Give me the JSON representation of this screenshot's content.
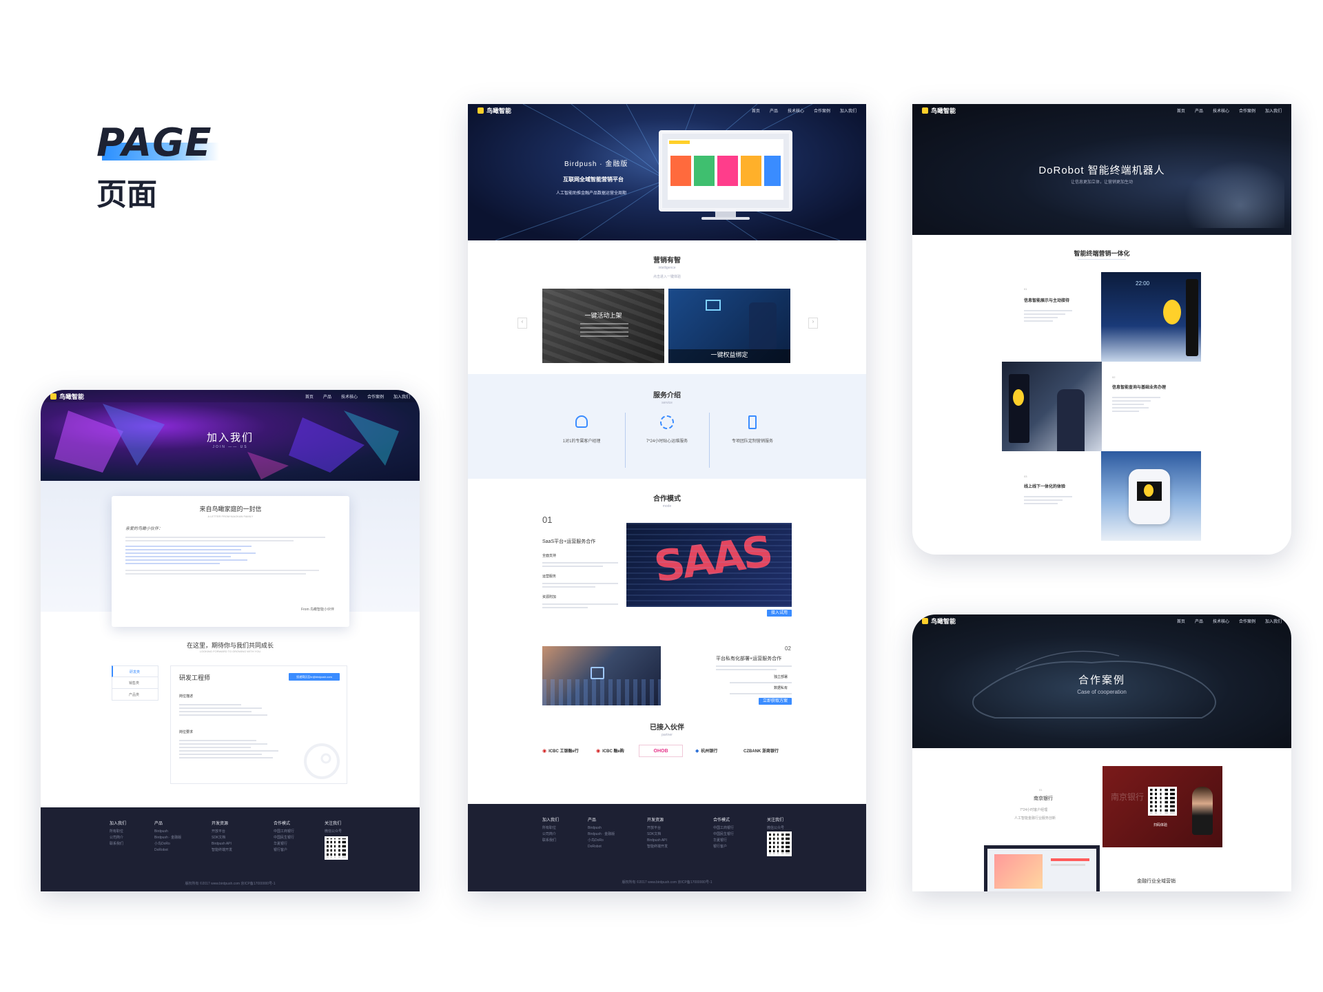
{
  "header": {
    "en": "PAGE",
    "zh": "页面"
  },
  "brand": {
    "logo_text": "鸟瞰智能",
    "accent": "#3a8cff",
    "dark": "#1d2033",
    "yellow": "#ffd02a"
  },
  "nav_main": [
    "首页",
    "产品",
    "技术核心",
    "合作案例",
    "加入我们"
  ],
  "join": {
    "hero_title": "加入我们",
    "hero_sub": "JOIN —— US",
    "letter_title": "来自鸟瞰家庭的一封信",
    "letter_sub": "A LETTER FROM NIAOKAN FAMILY",
    "letter_greeting": "亲爱的鸟瞰小伙伴：",
    "letter_sign": "From  鸟瞰智能小伙伴",
    "grow_title": "在这里，期待你与我们共同成长",
    "grow_sub": "LOOKING FORWARD TO GROWING WITH YOU",
    "tabs": [
      "研发类",
      "销售类",
      "产品类"
    ],
    "job_title": "研发工程师",
    "job_button": "投递简历至hr@birdpush.com",
    "job_desc_h": "岗位描述",
    "job_req_h": "岗位要求"
  },
  "footer": {
    "cols": [
      {
        "h": "加入我们",
        "items": [
          "所有职位",
          "公司简介",
          "联系我们"
        ]
      },
      {
        "h": "产品",
        "items": [
          "Birdpush",
          "Birdpush · 金融版",
          "小鸟DoRo",
          "DoRobot"
        ]
      },
      {
        "h": "开发资源",
        "items": [
          "开放平台",
          "SDK文档",
          "Birdpush API",
          "智能终端开发"
        ]
      },
      {
        "h": "合作模式",
        "items": [
          "中国工商银行",
          "中国民生银行",
          "华夏银行",
          "银行客户"
        ]
      },
      {
        "h": "关注我们",
        "items": [
          "微信公众号",
          "关注我们"
        ]
      }
    ],
    "copyright": "版权所有 ©2017 www.birdpush.com 京ICP备17000000号-1"
  },
  "center": {
    "hero_brand": "Birdpush · 金融版",
    "hero_title": "互联网全域智能营销平台",
    "hero_sub": "人工智能助推金融产品数据运营全周期",
    "s1_title": "营销有智",
    "s1_sub": "intelligence",
    "s1_desc": "点击进入一键体验",
    "card1_title": "一键活动上架",
    "card2_title": "一键权益绑定",
    "s2_title": "服务介绍",
    "s2_sub": "service",
    "services": [
      "1对1的专属客户经理",
      "7*24小时贴心运维服务",
      "专项团队定制营销服务"
    ],
    "s3_title": "合作模式",
    "s3_sub": "mode",
    "m1_num": "01",
    "m1_title": "SaaS平台+运营服务合作",
    "m1_h1": "全面支持",
    "m1_h2": "运营服务",
    "m1_h3": "资源附加",
    "m1_btn": "接入试用",
    "m2_num": "02",
    "m2_title": "平台私有化部署+运营服务合作",
    "m2_h1": "独立部署",
    "m2_h2": "数据私有",
    "m2_btn": "立即获取方案",
    "s4_title": "已接入伙伴",
    "s4_sub": "partner",
    "partners": [
      "ICBC 工银融e行",
      "ICBC 融e购",
      "OHOB",
      "杭州银行",
      "CZBANK 浙商银行"
    ]
  },
  "robot": {
    "hero_title": "DoRobot 智能终端机器人",
    "hero_sub": "让信息更加立体，让营销更加生动",
    "s_title": "智能终端营销一体化",
    "f1_num": "01",
    "f1_title": "信息智能展示与主动接待",
    "f2_num": "02",
    "f2_title": "信息智能查询与基础业务办理",
    "f3_num": "03",
    "f3_title": "线上线下一体化的体验",
    "screen_time": "22:00"
  },
  "cases": {
    "hero_title": "合作案例",
    "hero_sub": "Case of cooperation",
    "c1_num": "01",
    "c1_title": "南京银行",
    "c1_sub": "7*24小时客户经理",
    "c1_desc": "人工智能金融行业服务创新",
    "c1_card_label": "扫码体验",
    "c2_title": "金融行业全域营销"
  }
}
